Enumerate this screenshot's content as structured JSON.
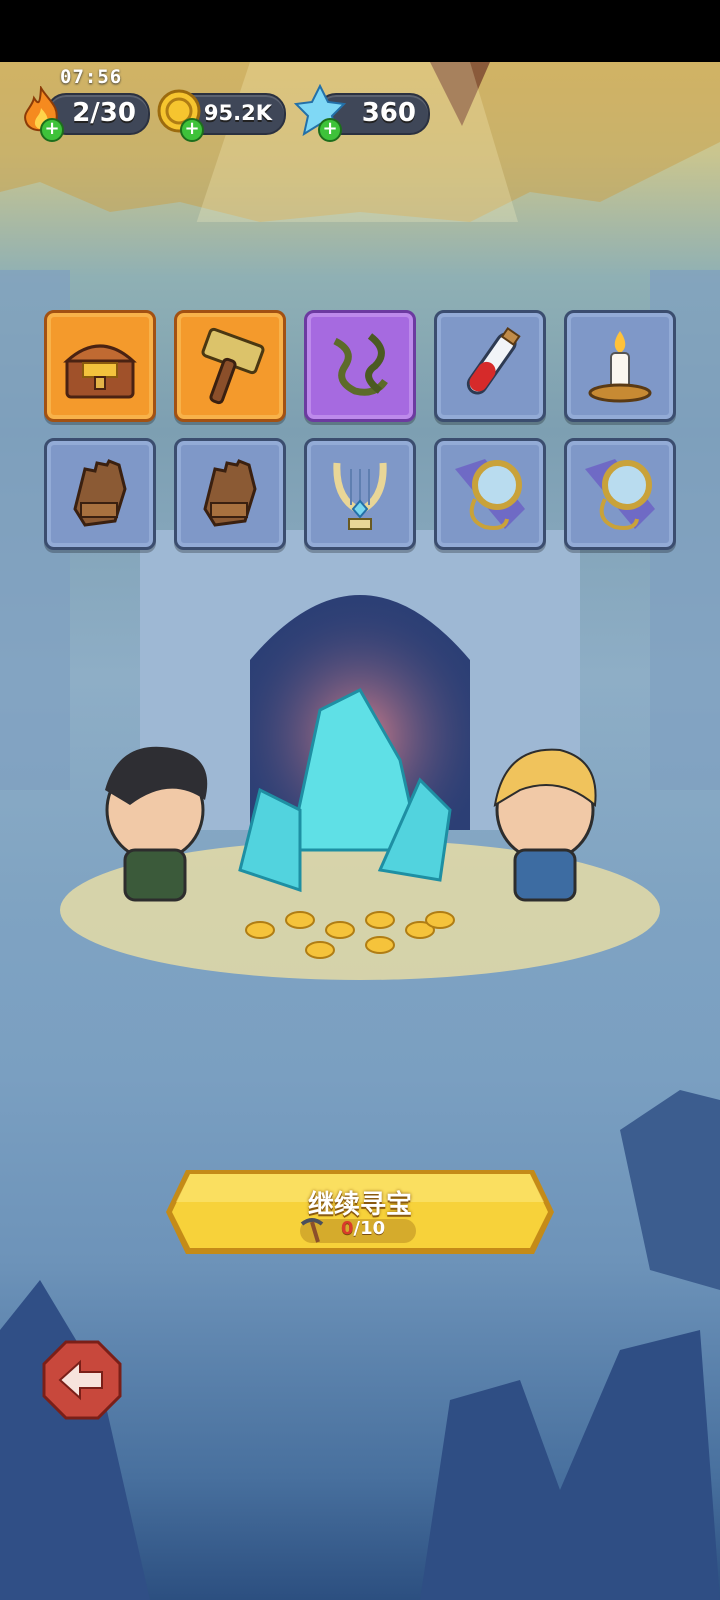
{
  "status": {
    "time": "07:56"
  },
  "resources": {
    "energy": {
      "value": "2/30",
      "icon": "flame-icon"
    },
    "gold": {
      "value": "95.2K",
      "icon": "gold-coin-icon"
    },
    "gems": {
      "value": "360",
      "icon": "blue-crystal-icon"
    }
  },
  "items": [
    {
      "name": "treasure-chest-icon",
      "rarity": "orange"
    },
    {
      "name": "hammer-icon",
      "rarity": "orange"
    },
    {
      "name": "thorn-vine-icon",
      "rarity": "purple"
    },
    {
      "name": "red-potion-icon",
      "rarity": "blue"
    },
    {
      "name": "candle-icon",
      "rarity": "blue"
    },
    {
      "name": "leather-glove-icon",
      "rarity": "blue"
    },
    {
      "name": "leather-glove-icon",
      "rarity": "blue"
    },
    {
      "name": "lyre-icon",
      "rarity": "blue"
    },
    {
      "name": "pocket-watch-icon",
      "rarity": "blue"
    },
    {
      "name": "pocket-watch-icon",
      "rarity": "blue"
    }
  ],
  "action": {
    "label": "继续寻宝",
    "count_current": "0",
    "count_total": "/10",
    "icon": "pickaxe-icon"
  },
  "back": {
    "icon": "back-arrow-icon"
  },
  "colors": {
    "orange_slot": "#f49a2c",
    "purple_slot": "#a66ae0",
    "blue_slot": "#7f98c8",
    "button_yellow": "#f7d23a"
  }
}
